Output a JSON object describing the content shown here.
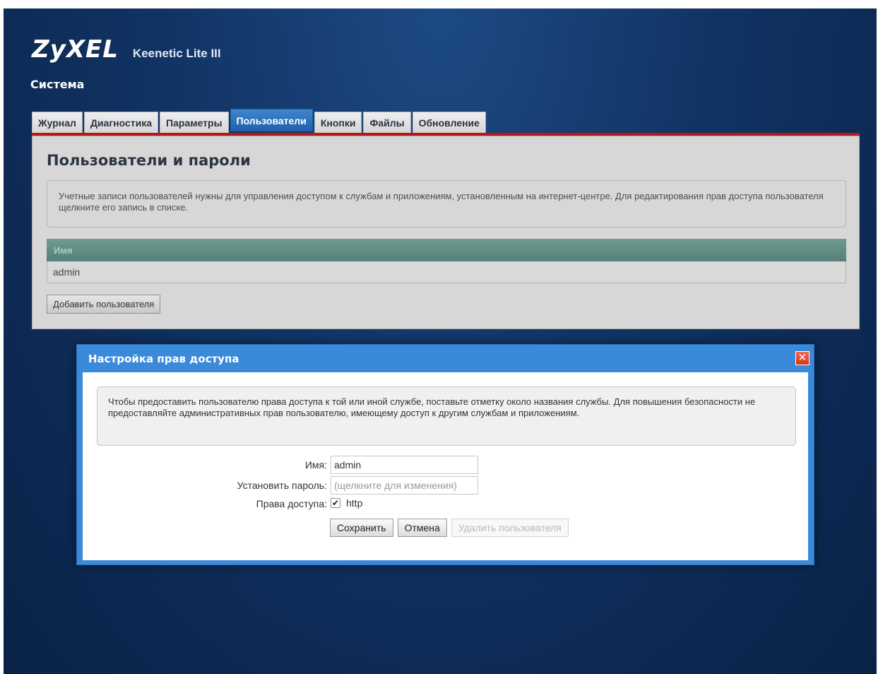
{
  "header": {
    "logo": "ZyXEL",
    "model": "Keenetic Lite III",
    "section_title": "Система"
  },
  "tabs": [
    {
      "label": "Журнал",
      "active": false
    },
    {
      "label": "Диагностика",
      "active": false
    },
    {
      "label": "Параметры",
      "active": false
    },
    {
      "label": "Пользователи",
      "active": true
    },
    {
      "label": "Кнопки",
      "active": false
    },
    {
      "label": "Файлы",
      "active": false
    },
    {
      "label": "Обновление",
      "active": false
    }
  ],
  "panel": {
    "title": "Пользователи и пароли",
    "info": "Учетные записи пользователей нужны для управления доступом к службам и приложениям, установленным на интернет-центре. Для редактирования прав доступа пользователя щелкните его запись в списке.",
    "table": {
      "header": "Имя",
      "rows": [
        "admin"
      ]
    },
    "add_button": "Добавить пользователя"
  },
  "dialog": {
    "title": "Настройка прав доступа",
    "close_glyph": "✕",
    "info": "Чтобы предоставить пользователю права доступа к той или иной службе, поставьте отметку около названия службы. Для повышения безопасности не предоставляйте административных прав пользователю, имеющему доступ к другим службам и приложениям.",
    "name_label": "Имя:",
    "name_value": "admin",
    "password_label": "Установить пароль:",
    "password_placeholder": "(щелкните для изменения)",
    "access_label": "Права доступа:",
    "access_option": "http",
    "access_checked": true,
    "check_glyph": "✔",
    "save_button": "Сохранить",
    "cancel_button": "Отмена",
    "delete_button": "Удалить пользователя"
  },
  "colors": {
    "background": "#113363",
    "active_tab": "#2f74bf",
    "tab_underline": "#b61818",
    "table_header": "#628d84",
    "dialog_frame": "#3a8ad9",
    "close_button": "#e04a2f"
  }
}
